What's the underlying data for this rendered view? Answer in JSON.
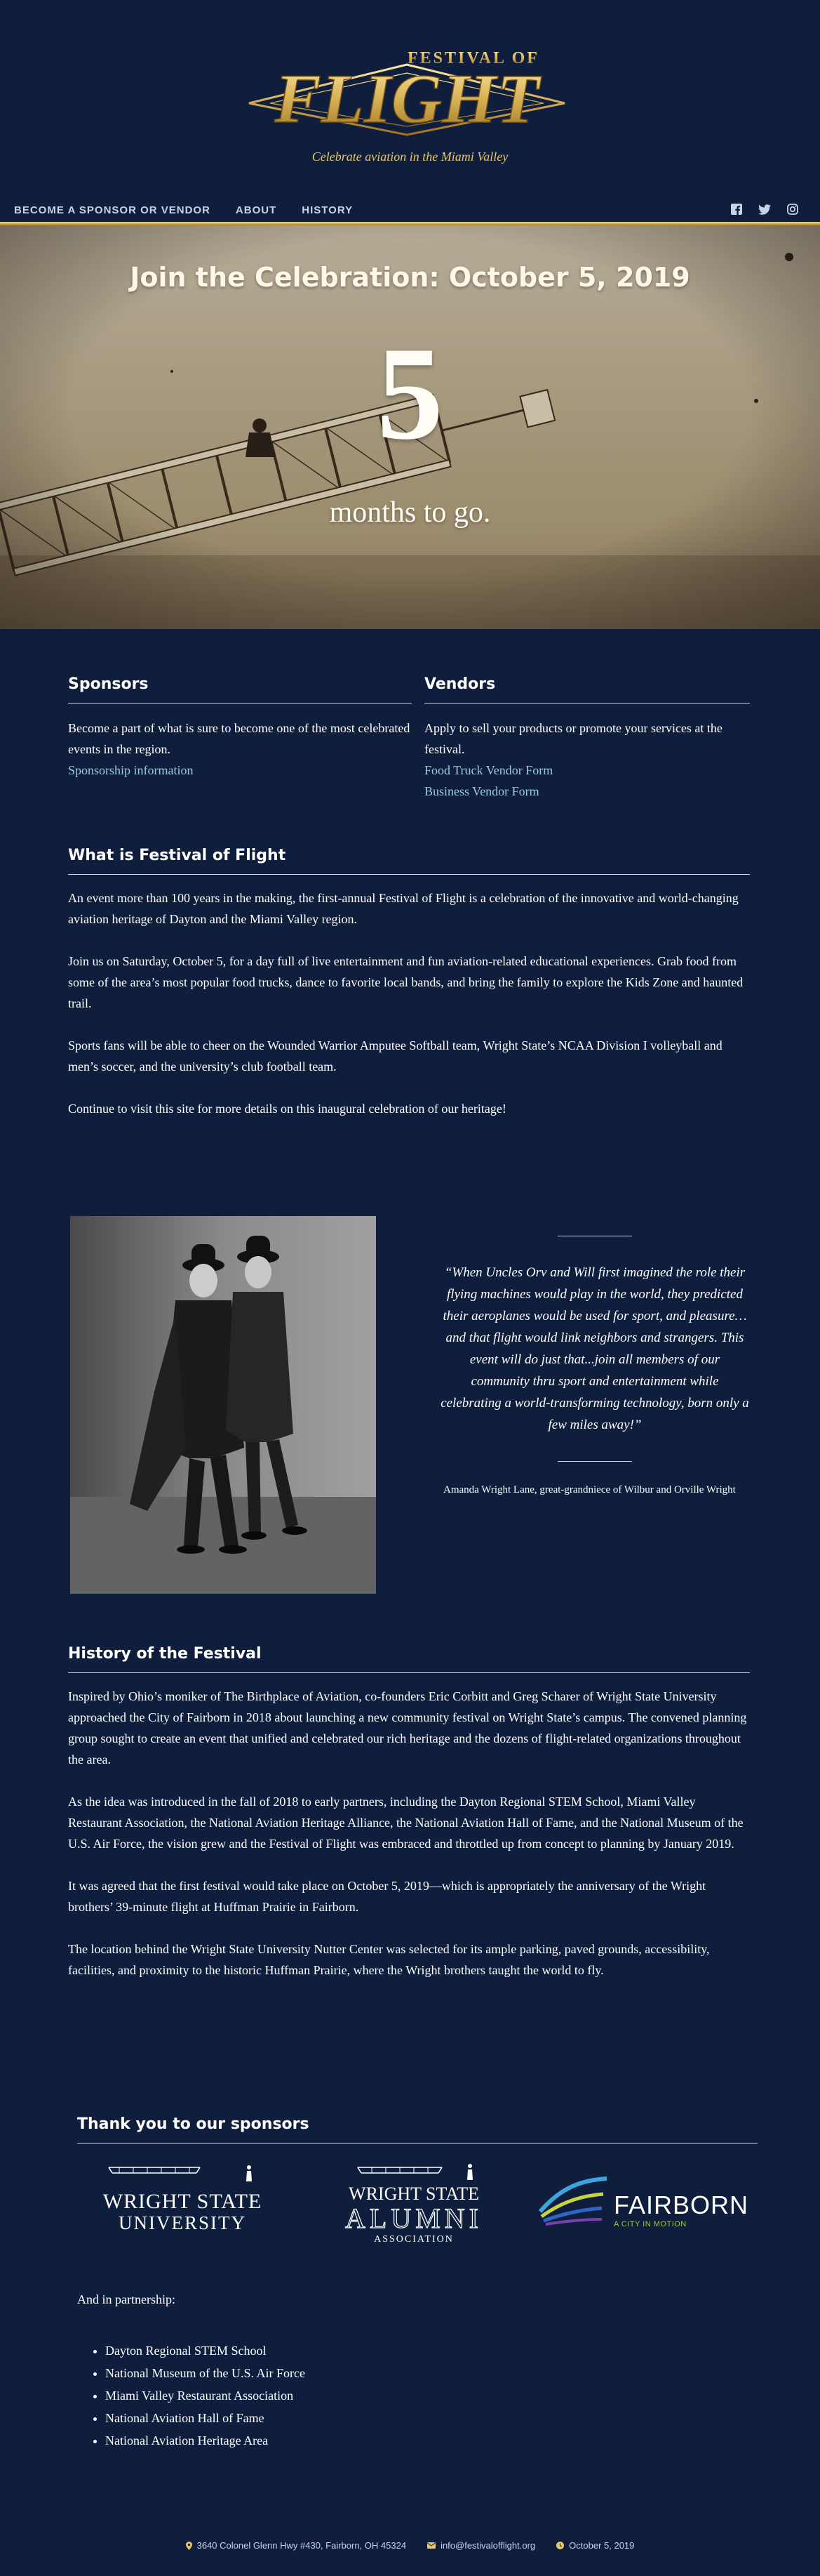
{
  "header": {
    "logo_small": "FESTIVAL OF",
    "logo_big": "FLIGHT",
    "tagline": "Celebrate aviation in the Miami Valley",
    "nav": [
      "BECOME A SPONSOR OR VENDOR",
      "ABOUT",
      "HISTORY"
    ],
    "social_icons": [
      "facebook-icon",
      "twitter-icon",
      "instagram-icon"
    ],
    "colors": {
      "navy": "#0f1e3d",
      "gold": "#e8c766",
      "link": "#9cc9e0"
    }
  },
  "hero": {
    "title": "Join the Celebration: October 5, 2019",
    "count": "5",
    "subtitle": "months to go."
  },
  "sponsors": {
    "heading": "Sponsors",
    "text": "Become a part of what is sure to become one of the most celebrated events in the region.",
    "link": "Sponsorship information"
  },
  "vendors": {
    "heading": "Vendors",
    "text": "Apply to sell your products or promote your services at the festival.",
    "links": [
      "Food Truck Vendor Form",
      "Business Vendor Form"
    ]
  },
  "about": {
    "heading": "What is Festival of Flight",
    "paragraphs": [
      "An event more than 100 years in the making, the first-annual Festival of Flight is a celebration of the innovative and world-changing aviation heritage of Dayton and the Miami Valley region.",
      "Join us on Saturday, October 5, for a day full of live entertainment and fun aviation-related educational experiences. Grab food from some of the area’s most popular food trucks, dance to favorite local bands, and bring the family to explore the Kids Zone and haunted trail.",
      "Sports fans will be able to cheer on the Wounded Warrior Amputee Softball team, Wright State’s NCAA Division I volleyball and men’s soccer, and the university’s club football team.",
      "Continue to visit this site for more details on this inaugural celebration of our heritage!"
    ]
  },
  "quote": {
    "text": "“When Uncles Orv and Will first imagined the role their flying machines would play in the world, they predicted their aeroplanes would be used for sport, and pleasure…and that flight would link neighbors and strangers. This event will do just that...join all members of our community thru sport and entertainment while celebrating a world-transforming technology, born only a few miles away!”",
    "attribution": "Amanda Wright Lane, great-grandniece of Wilbur and Orville Wright"
  },
  "history": {
    "heading": "History of the Festival",
    "paragraphs": [
      "Inspired by Ohio’s moniker of The Birthplace of Aviation, co-founders Eric Corbitt and Greg Scharer of Wright State University approached the City of Fairborn in 2018 about launching a new community festival on Wright State’s campus. The convened planning group sought to create an event that unified and celebrated our rich heritage and the dozens of flight-related organizations throughout the area.",
      "As the idea was introduced in the fall of 2018 to early partners, including the Dayton Regional STEM School, Miami Valley Restaurant Association, the National Aviation Heritage Alliance, the National Aviation Hall of Fame, and the National Museum of the U.S. Air Force, the vision grew and the Festival of Flight was embraced and throttled up from concept to planning by January 2019.",
      "It was agreed that the first festival would take place on October 5, 2019—which is appropriately the anniversary of the Wright brothers’ 39-minute flight at Huffman Prairie in Fairborn.",
      "The location behind the Wright State University Nutter Center was selected for its ample parking, paved grounds, accessibility, facilities, and proximity to the historic Huffman Prairie, where the Wright brothers taught the world to fly."
    ]
  },
  "thanks": {
    "heading": "Thank you to our sponsors",
    "logos": [
      {
        "line1": "WRIGHT STATE",
        "line2": "UNIVERSITY"
      },
      {
        "line1": "WRIGHT STATE",
        "line2": "ALUMNI",
        "line3": "ASSOCIATION"
      },
      {
        "line1": "FAIRBORN",
        "line2": "A CITY IN MOTION"
      }
    ],
    "partnership_label": "And in partnership:",
    "partners": [
      "Dayton Regional STEM School",
      "National Museum of the U.S. Air Force",
      "Miami Valley Restaurant Association",
      "National Aviation Hall of Fame",
      "National Aviation Heritage Area"
    ]
  },
  "footer": {
    "address": "3640 Colonel Glenn Hwy #430, Fairborn, OH 45324",
    "email": "info@festivalofflight.org",
    "date": "October 5, 2019"
  }
}
